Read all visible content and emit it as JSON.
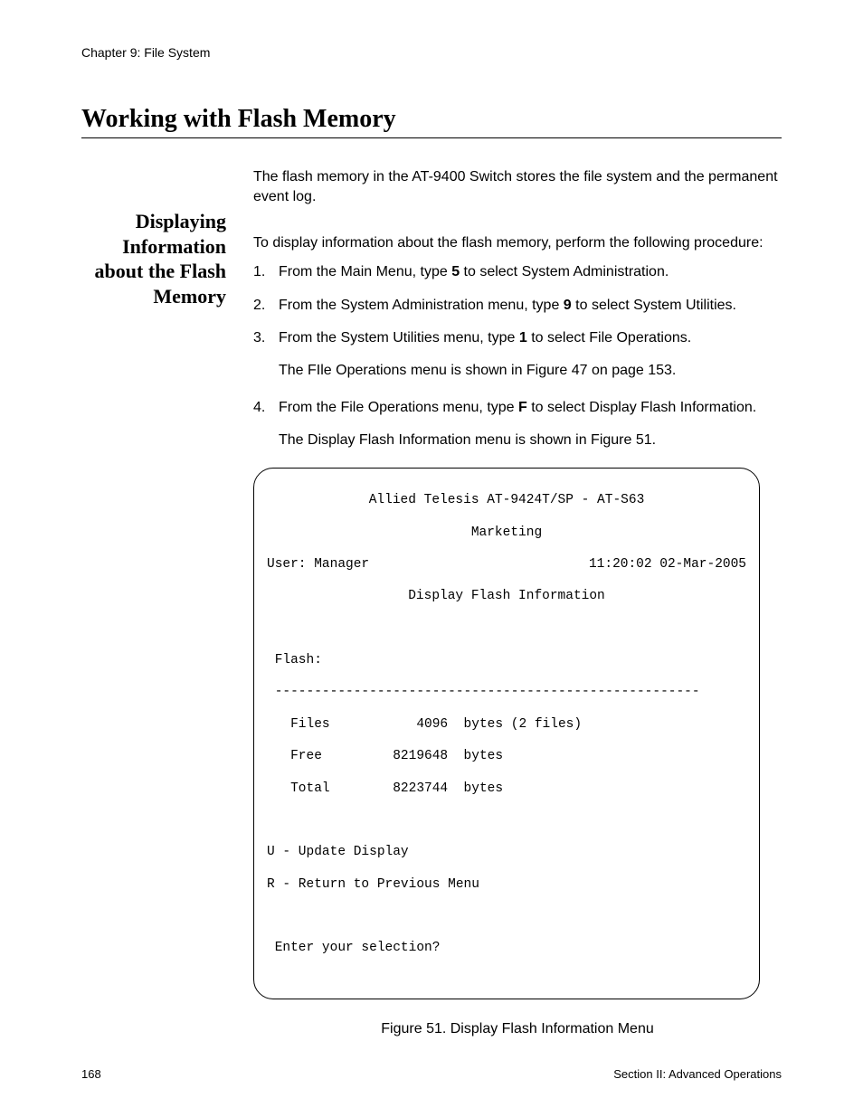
{
  "header": {
    "chapter": "Chapter 9: File System"
  },
  "heading": "Working with Flash Memory",
  "intro": "The flash memory in the AT-9400 Switch stores the file system and the permanent event log.",
  "sidebar_title_lines": [
    "Displaying",
    "Information",
    "about the Flash",
    "Memory"
  ],
  "lead": "To display information about the flash memory, perform the following procedure:",
  "steps": {
    "s1": {
      "num": "1.",
      "pre": "From the Main Menu, type ",
      "bold": "5",
      "post": " to select System Administration."
    },
    "s2": {
      "num": "2.",
      "pre": "From the System Administration menu, type ",
      "bold": "9",
      "post": " to select System Utilities."
    },
    "s3": {
      "num": "3.",
      "pre": "From the System Utilities menu, type ",
      "bold": "1",
      "post": " to select File Operations."
    },
    "s3_note": "The FIle Operations menu is shown in Figure 47 on page 153.",
    "s4": {
      "num": "4.",
      "pre": "From the File Operations menu, type ",
      "bold": "F",
      "post": " to select Display Flash Information."
    },
    "s4_note": "The Display Flash Information menu is shown in Figure 51."
  },
  "terminal": {
    "line1": "Allied Telesis AT-9424T/SP - AT-S63",
    "line2": "Marketing",
    "user_label": "User: Manager",
    "timestamp": "11:20:02 02-Mar-2005",
    "title": "Display Flash Information",
    "flash_label": " Flash:",
    "divider": " ------------------------------------------------------",
    "row_files": "   Files           4096  bytes (2 files)",
    "row_free": "   Free         8219648  bytes",
    "row_total": "   Total        8223744  bytes",
    "opt_u": "U - Update Display",
    "opt_r": "R - Return to Previous Menu",
    "prompt": " Enter your selection?"
  },
  "figure_caption": "Figure 51. Display Flash Information Menu",
  "footer": {
    "page_num": "168",
    "section": "Section II: Advanced Operations"
  }
}
